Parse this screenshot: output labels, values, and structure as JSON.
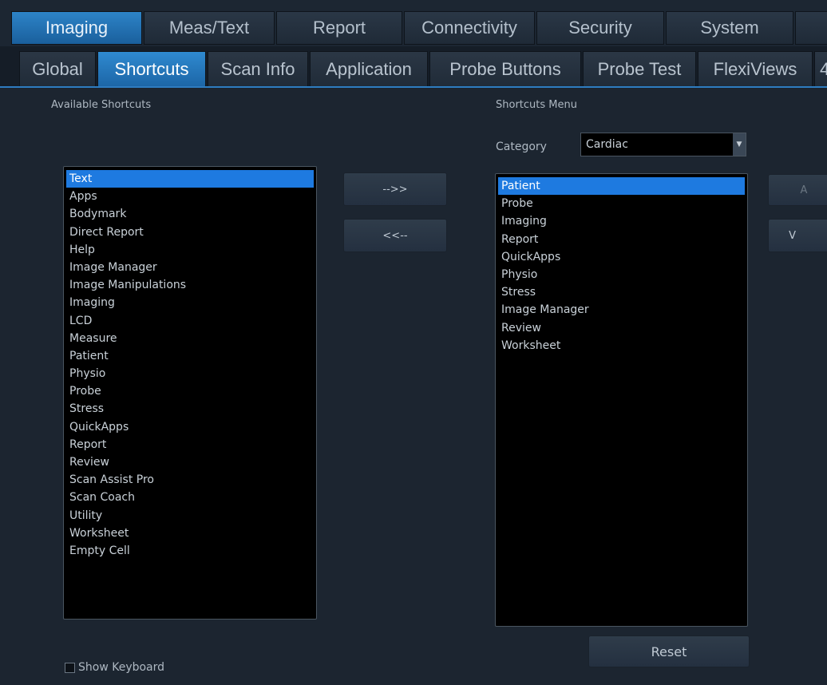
{
  "top_tabs": [
    {
      "label": "Imaging",
      "active": true
    },
    {
      "label": "Meas/Text",
      "active": false
    },
    {
      "label": "Report",
      "active": false
    },
    {
      "label": "Connectivity",
      "active": false
    },
    {
      "label": "Security",
      "active": false
    },
    {
      "label": "System",
      "active": false
    },
    {
      "label": "",
      "active": false
    }
  ],
  "sub_tabs": [
    {
      "label": "Global",
      "active": false
    },
    {
      "label": "Shortcuts",
      "active": true
    },
    {
      "label": "Scan Info",
      "active": false
    },
    {
      "label": "Application",
      "active": false
    },
    {
      "label": "Probe Buttons",
      "active": false
    },
    {
      "label": "Probe Test",
      "active": false
    },
    {
      "label": "FlexiViews",
      "active": false
    },
    {
      "label": "4",
      "active": false
    }
  ],
  "available": {
    "title": "Available Shortcuts",
    "items": [
      "Text",
      "Apps",
      "Bodymark",
      "Direct Report",
      "Help",
      "Image Manager",
      "Image Manipulations",
      "Imaging",
      "LCD",
      "Measure",
      "Patient",
      "Physio",
      "Probe",
      "Stress",
      "QuickApps",
      "Report",
      "Review",
      "Scan Assist Pro",
      "Scan Coach",
      "Utility",
      "Worksheet",
      "Empty Cell"
    ],
    "selected_index": 0
  },
  "transfer": {
    "add_label": "-->>",
    "remove_label": "<<--"
  },
  "menu": {
    "title": "Shortcuts Menu",
    "category_label": "Category",
    "category_value": "Cardiac",
    "items": [
      "Patient",
      "Probe",
      "Imaging",
      "Report",
      "QuickApps",
      "Physio",
      "Stress",
      "Image Manager",
      "Review",
      "Worksheet"
    ],
    "selected_index": 0
  },
  "side_buttons": [
    "A",
    "V"
  ],
  "reset_label": "Reset",
  "show_keyboard_label": "Show Keyboard"
}
